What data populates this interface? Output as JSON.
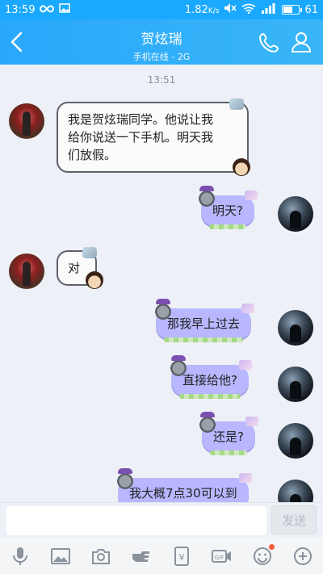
{
  "status_bar": {
    "time": "13:59",
    "speed": "1.82",
    "speed_unit": "K/s",
    "battery": "61",
    "battery_level": 0.61
  },
  "header": {
    "contact_name": "贺炫瑞",
    "status": "手机在线 - 2G",
    "back_icon": "chevron-left-icon",
    "call_icon": "phone-icon",
    "profile_icon": "person-icon"
  },
  "chat": {
    "timestamp": "13:51",
    "messages": [
      {
        "sender": "friend",
        "text": "我是贺炫瑞同学。他说让我\n给你说送一下手机。明天我\n们放假。"
      },
      {
        "sender": "me",
        "text": "明天?"
      },
      {
        "sender": "friend",
        "text": "对"
      },
      {
        "sender": "me",
        "text": "那我早上过去"
      },
      {
        "sender": "me",
        "text": "直接给他?"
      },
      {
        "sender": "me",
        "text": "还是?"
      },
      {
        "sender": "me",
        "text": "我大概7点30可以到"
      }
    ]
  },
  "input": {
    "value": "",
    "send_label": "发送"
  },
  "toolbar": {
    "icons": [
      "microphone-icon",
      "image-icon",
      "camera-icon",
      "hand-poke-icon",
      "red-packet-icon",
      "gif-icon",
      "emoji-icon",
      "plus-icon"
    ]
  },
  "colors": {
    "header": "#29a7fb",
    "chat_background": "#edf1f7",
    "my_bubble": "#b8b7ff",
    "friend_bubble": "#fbfbfb",
    "notification_dot": "#f25c3a"
  }
}
